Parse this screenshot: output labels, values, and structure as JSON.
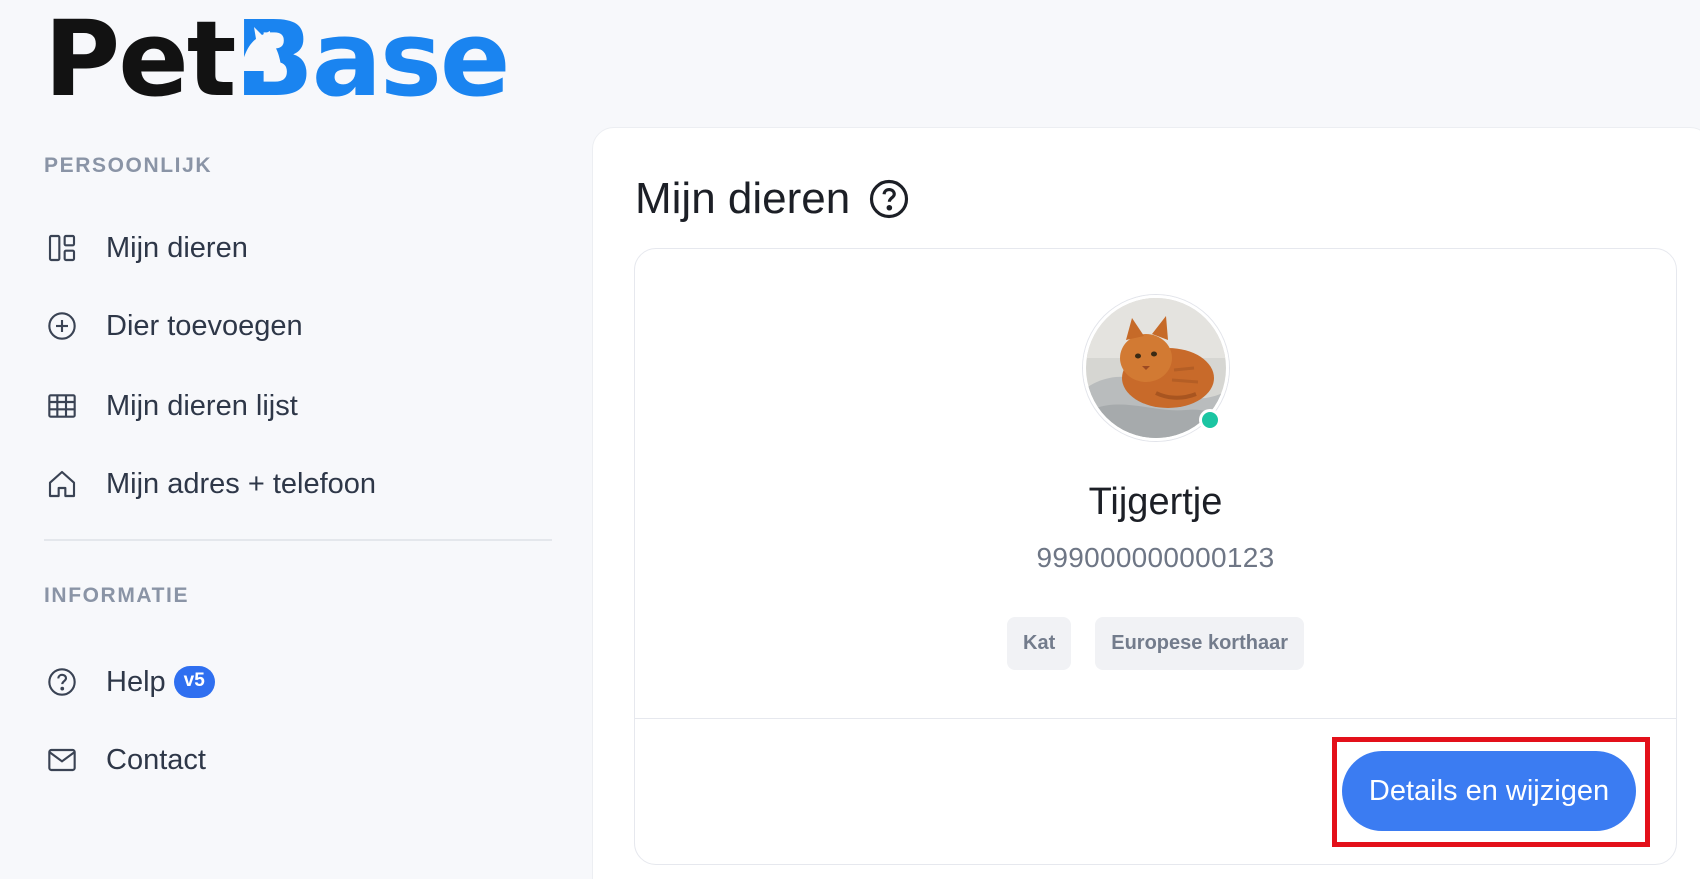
{
  "logo": {
    "part1": "Pet",
    "part2": "ase",
    "b_alt": "B"
  },
  "sidebar": {
    "section_personal": "PERSOONLIJK",
    "items_personal": [
      {
        "label": "Mijn dieren",
        "icon": "dashboard-icon"
      },
      {
        "label": "Dier toevoegen",
        "icon": "plus-circle-icon"
      },
      {
        "label": "Mijn dieren lijst",
        "icon": "table-icon"
      },
      {
        "label": "Mijn adres + telefoon",
        "icon": "home-icon"
      }
    ],
    "section_info": "INFORMATIE",
    "items_info": [
      {
        "label": "Help",
        "icon": "question-circle-icon",
        "badge": "v5"
      },
      {
        "label": "Contact",
        "icon": "envelope-icon"
      }
    ]
  },
  "main": {
    "title": "Mijn dieren",
    "pet": {
      "name": "Tijgertje",
      "chip_number": "999000000000123",
      "tags": [
        "Kat",
        "Europese korthaar"
      ],
      "status_color": "#1bc5a2",
      "details_button": "Details en wijzigen"
    }
  },
  "colors": {
    "brand_blue": "#1a84f0",
    "button_blue": "#3b7cf2",
    "highlight_red": "#e3101a"
  }
}
